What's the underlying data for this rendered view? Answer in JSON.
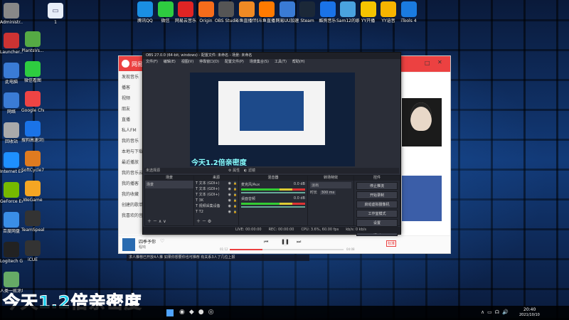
{
  "desktop_top": [
    "腾讯QQ",
    "微信",
    "网易云音乐",
    "Origin",
    "OBS Studio",
    "斗鱼直播伴侣",
    "斗鱼直播",
    "网易UU加速器",
    "Steam",
    "酷狗音乐",
    "Sam12的歌",
    "YY开播",
    "YY语音",
    "iTools 4"
  ],
  "desktop_left": [
    "Administr...",
    "Launcher...",
    "此电脑",
    "网络",
    "回收站",
    "Internet Explorer",
    "GeForce Experience",
    "百度网盘",
    "Logitech G HUB",
    "人类一败涂地 Human Fa...",
    "PlantsVs...",
    "微信看图",
    "Google Chrome",
    "搜狗高速浏览器",
    "SoftCycle7 2021版",
    "WeGame",
    "TeamSpeak 3",
    "iCUE"
  ],
  "desktop_file": "1",
  "netease": {
    "logo": "网易",
    "sidebar": [
      "发现音乐",
      "播客",
      "视频",
      "朋友",
      "直播",
      "私人FM",
      "我的音乐",
      "本地与下载",
      "最近播放",
      "我的音乐云盘",
      "我的播客",
      "我的收藏",
      "创建的歌单",
      "我喜欢的音乐"
    ],
    "song_title": "四季予你",
    "artist": "程响",
    "time_current": "01:12",
    "time_total": "04:08",
    "quality_badge": "标准",
    "notice": "求人推荐已开放4人推 如果你想要你也可推荐 有关系3人了几位上报"
  },
  "obs": {
    "title": "OBS 27.0.0 (64-bit, windows) - 配置文件: 未命名 - 场景: 未命名",
    "menu": [
      "文件(F)",
      "编辑(E)",
      "视图(V)",
      "停靠窗口(D)",
      "配置文件(P)",
      "场景集合(S)",
      "工具(T)",
      "帮助(H)"
    ],
    "preview_caption": "今天1.2倍亲密度",
    "no_source": "未选择源",
    "props_button": "属性",
    "filter_button": "滤镜",
    "docks": {
      "scenes": "场景",
      "sources": "来源",
      "mixer": "混音器",
      "transitions": "转场特效",
      "controls": "控件"
    },
    "scene_name": "场景",
    "sources": [
      "文本 (GDI+)",
      "文本 (GDI+)",
      "文本 (GDI+)",
      "3K",
      "视频采集设备",
      "T2"
    ],
    "mixer": [
      {
        "name": "麦克风/Aux",
        "db": "0.0 dB"
      },
      {
        "name": "桌面音频",
        "db": "0.0 dB"
      }
    ],
    "transition_select": "淡出",
    "duration_label": "时长",
    "duration_value": "300 ms",
    "controls": [
      "停止推流",
      "开始录制",
      "启动虚拟摄像机",
      "工作室模式",
      "设置",
      "退出"
    ],
    "status": [
      "LIVE: 00:00:00",
      "REC: 00:00:00",
      "CPU: 3.6%, 60.00 fps",
      "kb/s: 0 kb/s"
    ]
  },
  "overlay_text": "今天1.2倍亲密度",
  "taskbar": {
    "time": "20:40",
    "date": "2021/10/10"
  }
}
